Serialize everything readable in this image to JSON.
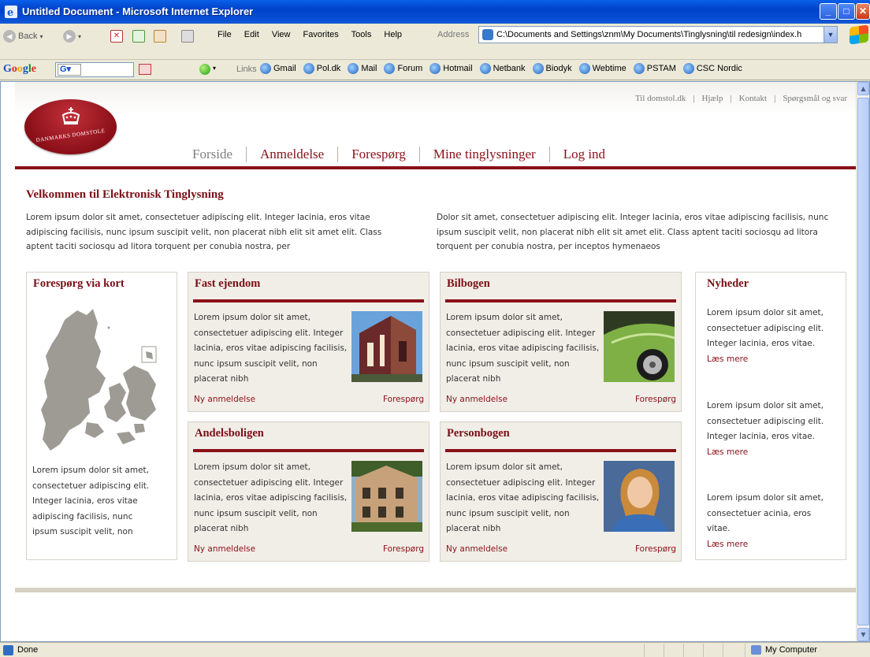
{
  "window": {
    "title": "Untitled Document - Microsoft Internet Explorer",
    "minimize": "_",
    "maximize": "□",
    "close": "✕"
  },
  "toolbar": {
    "back": "Back",
    "menu": [
      "File",
      "Edit",
      "View",
      "Favorites",
      "Tools",
      "Help"
    ],
    "address_label": "Address",
    "address_value": "C:\\Documents and Settings\\znm\\My Documents\\Tinglysning\\til redesign\\index.h"
  },
  "google_bar": {
    "brand": [
      "G",
      "o",
      "o",
      "g",
      "l",
      "e"
    ],
    "search_logo": "G▾",
    "links_label": "Links",
    "links": [
      "Gmail",
      "Pol.dk",
      "Mail",
      "Forum",
      "Hotmail",
      "Netbank",
      "Biodyk",
      "Webtime",
      "PSTAM",
      "CSC Nordic"
    ]
  },
  "site": {
    "logo_text": "DANMARKS DOMSTOLE",
    "top_links": [
      "Til domstol.dk",
      "Hjælp",
      "Kontakt",
      "Spørgsmål og svar"
    ],
    "nav": [
      "Forside",
      "Anmeldelse",
      "Forespørg",
      "Mine tinglysninger",
      "Log ind"
    ],
    "welcome_title": "Velkommen til Elektronisk Tinglysning",
    "intro_left": "Lorem ipsum dolor sit amet, consectetuer adipiscing elit. Integer lacinia, eros vitae adipiscing facilisis, nunc ipsum suscipit velit, non placerat nibh elit sit amet elit. Class aptent taciti sociosqu ad litora torquent per conubia nostra, per",
    "intro_right": "Dolor sit amet, consectetuer adipiscing elit. Integer lacinia, eros vitae adipiscing facilisis, nunc ipsum suscipit velit, non placerat nibh elit sit amet elit. Class aptent taciti sociosqu ad litora torquent per conubia nostra, per inceptos hymenaeos",
    "map_box": {
      "title": "Forespørg via kort",
      "text": "Lorem ipsum dolor sit amet, consectetuer adipiscing elit. Integer lacinia, eros vitae adipiscing facilisis, nunc ipsum suscipit velit, non"
    },
    "cards": [
      {
        "title": "Fast ejendom",
        "text": "Lorem ipsum dolor sit amet, consectetuer adipiscing elit. Integer lacinia, eros vitae adipiscing facilisis, nunc ipsum suscipit velit, non placerat nibh",
        "link_left": "Ny anmeldelse",
        "link_right": "Forespørg"
      },
      {
        "title": "Bilbogen",
        "text": "Lorem ipsum dolor sit amet, consectetuer adipiscing elit. Integer lacinia, eros vitae adipiscing facilisis, nunc ipsum suscipit velit, non placerat nibh",
        "link_left": "Ny anmeldelse",
        "link_right": "Forespørg"
      },
      {
        "title": "Andelsboligen",
        "text": "Lorem ipsum dolor sit amet, consectetuer adipiscing elit. Integer lacinia, eros vitae adipiscing facilisis, nunc ipsum suscipit velit, non placerat nibh",
        "link_left": "Ny anmeldelse",
        "link_right": "Forespørg"
      },
      {
        "title": "Personbogen",
        "text": "Lorem ipsum dolor sit amet, consectetuer adipiscing elit. Integer lacinia, eros vitae adipiscing facilisis, nunc ipsum suscipit velit, non placerat nibh",
        "link_left": "Ny anmeldelse",
        "link_right": "Forespørg"
      }
    ],
    "news": {
      "title": "Nyheder",
      "items": [
        {
          "text": "Lorem ipsum dolor sit amet, consectetuer adipiscing elit. Integer lacinia, eros vitae.",
          "more": "Læs mere"
        },
        {
          "text": "Lorem ipsum dolor sit amet, consectetuer adipiscing elit. Integer lacinia, eros vitae.",
          "more": "Læs mere"
        },
        {
          "text": "Lorem ipsum dolor sit amet, consectetuer acinia, eros vitae.",
          "more": "Læs mere"
        }
      ]
    }
  },
  "status": {
    "text": "Done",
    "zone": "My Computer"
  },
  "colors": {
    "brand_red": "#8a1018",
    "card_beige": "#f1eee8",
    "xp_blue": "#0a5fe8"
  }
}
